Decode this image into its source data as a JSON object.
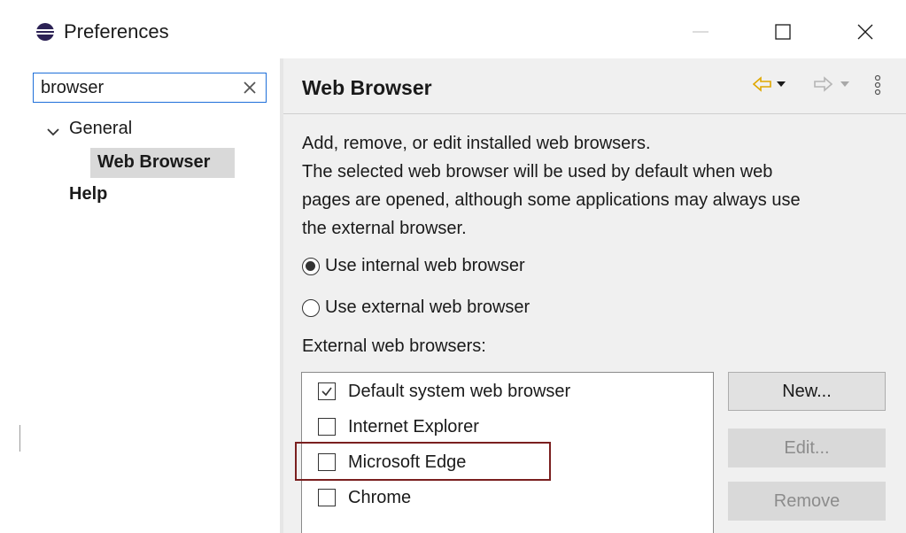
{
  "window": {
    "title": "Preferences",
    "icons": {
      "app": "eclipse-icon",
      "minimize": "minimize-icon",
      "maximize": "maximize-icon",
      "close": "close-icon"
    }
  },
  "sidebar": {
    "filter_value": "browser",
    "tree": {
      "general": "General",
      "web_browser": "Web Browser",
      "help": "Help"
    },
    "selected": "Web Browser"
  },
  "page": {
    "title": "Web Browser",
    "description": [
      "Add, remove, or edit installed web browsers.",
      "The selected web browser will be used by default when web",
      "pages are opened, although some applications may always use",
      "the external browser."
    ],
    "radio_internal": "Use internal web browser",
    "radio_external": "Use external web browser",
    "radio_selected": "internal",
    "external_label": "External web browsers:",
    "browsers": [
      {
        "name": "Default system web browser",
        "checked": true
      },
      {
        "name": "Internet Explorer",
        "checked": false
      },
      {
        "name": "Microsoft Edge",
        "checked": false
      },
      {
        "name": "Chrome",
        "checked": false
      }
    ],
    "highlighted_browser": "Microsoft Edge",
    "buttons": {
      "new": "New...",
      "edit": "Edit...",
      "remove": "Remove"
    },
    "button_states": {
      "new": "enabled",
      "edit": "disabled",
      "remove": "disabled"
    }
  },
  "colors": {
    "accent": "#1e6fd9",
    "highlight_border": "#7a1f1f",
    "nav_arrow": "#f0b400",
    "selection_bg": "#d9d9d9"
  }
}
